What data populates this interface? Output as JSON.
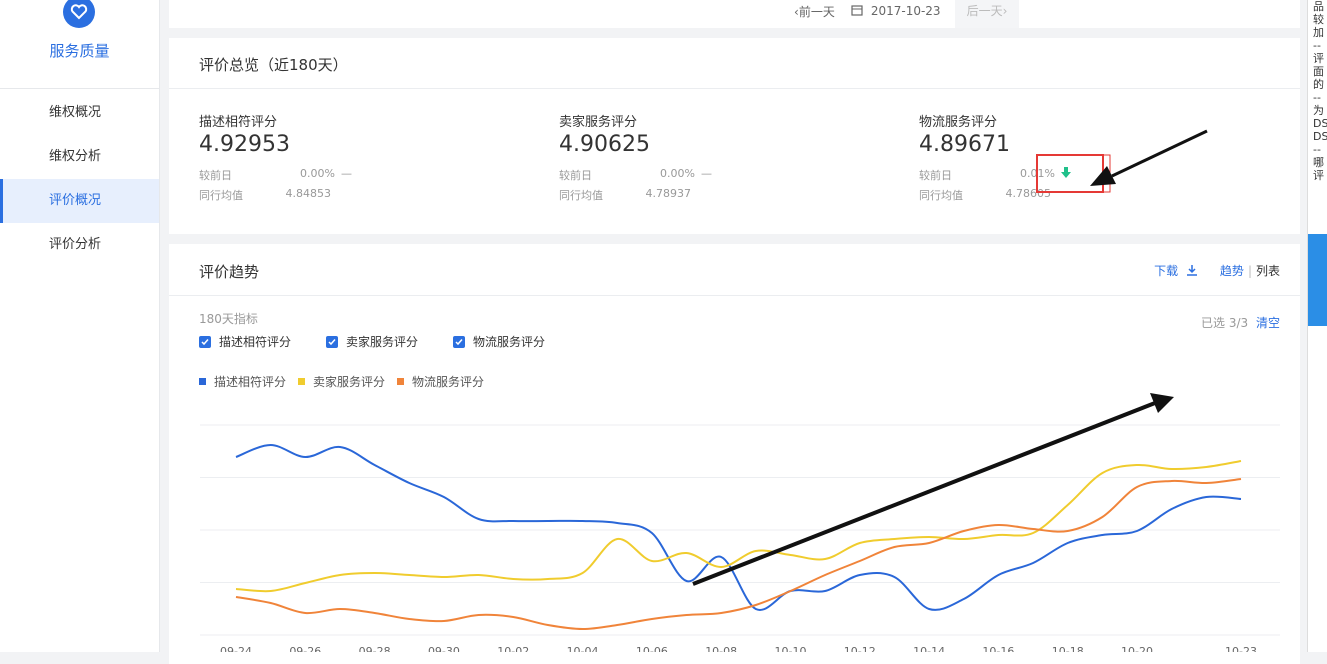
{
  "sidebar": {
    "brand_title": "服务质量",
    "items": [
      {
        "label": "维权概况",
        "active": false
      },
      {
        "label": "维权分析",
        "active": false
      },
      {
        "label": "评价概况",
        "active": true
      },
      {
        "label": "评价分析",
        "active": false
      }
    ]
  },
  "datenav": {
    "prev": "前一天",
    "date": "2017-10-23",
    "next": "后一天"
  },
  "overview": {
    "title": "评价总览（近180天）",
    "compare_label": "较前日",
    "avg_label": "同行均值",
    "metrics": [
      {
        "label": "描述相符评分",
        "value": "4.92953",
        "change": "0.00%",
        "indicator": "—",
        "avg": "4.84853"
      },
      {
        "label": "卖家服务评分",
        "value": "4.90625",
        "change": "0.00%",
        "indicator": "—",
        "avg": "4.78937"
      },
      {
        "label": "物流服务评分",
        "value": "4.89671",
        "change": "0.01%",
        "indicator": "down-arrow",
        "avg": "4.78605"
      }
    ]
  },
  "trend": {
    "title": "评价趋势",
    "download": "下载",
    "view_trend": "趋势",
    "view_list": "列表",
    "sub_label": "180天指标",
    "selected_label": "已选 3/3",
    "clear_label": "清空",
    "checkboxes": [
      "描述相符评分",
      "卖家服务评分",
      "物流服务评分"
    ]
  },
  "chart_data": {
    "type": "line",
    "categories": [
      "09-24",
      "09-25",
      "09-26",
      "09-27",
      "09-28",
      "09-29",
      "09-30",
      "10-01",
      "10-02",
      "10-03",
      "10-04",
      "10-05",
      "10-06",
      "10-07",
      "10-08",
      "10-09",
      "10-10",
      "10-11",
      "10-12",
      "10-13",
      "10-14",
      "10-15",
      "10-16",
      "10-17",
      "10-18",
      "10-19",
      "10-20",
      "10-21",
      "10-22",
      "10-23"
    ],
    "tick_labels": [
      "09-24",
      "09-26",
      "09-28",
      "09-30",
      "10-02",
      "10-04",
      "10-06",
      "10-08",
      "10-10",
      "10-12",
      "10-14",
      "10-16",
      "10-18",
      "10-20",
      "10-23"
    ],
    "series": [
      {
        "name": "描述相符评分",
        "color": "#2a67d8",
        "values": [
          84,
          90,
          84,
          89,
          80,
          71,
          64,
          53,
          52,
          52,
          52,
          51,
          46,
          22,
          34,
          8,
          17,
          17,
          25,
          24,
          8,
          13,
          25,
          31,
          41,
          45,
          47,
          58,
          64,
          63
        ]
      },
      {
        "name": "卖家服务评分",
        "color": "#f0cc2e",
        "values": [
          18,
          17,
          21,
          25,
          26,
          25,
          24,
          25,
          23,
          23,
          26,
          43,
          32,
          36,
          29,
          37,
          35,
          33,
          41,
          43,
          44,
          43,
          45,
          46,
          60,
          76,
          80,
          78,
          79,
          82
        ]
      },
      {
        "name": "物流服务评分",
        "color": "#f0843a",
        "values": [
          14,
          11,
          6,
          8,
          6,
          3,
          2,
          5,
          4,
          0,
          -2,
          0,
          3,
          5,
          6,
          10,
          17,
          25,
          32,
          39,
          41,
          47,
          50,
          48,
          47,
          54,
          69,
          72,
          71,
          73
        ]
      }
    ],
    "grid": true,
    "legend": "top-left"
  },
  "right_panel": {
    "text": [
      "品",
      "较",
      "加",
      "--",
      "评",
      "面",
      "的",
      "--",
      "为",
      "DS",
      "DS",
      "--",
      "哪",
      "评"
    ]
  },
  "colors": {
    "accent": "#2b6fe0",
    "highlight_box": "#e53935",
    "down_arrow": "#20c08a"
  }
}
